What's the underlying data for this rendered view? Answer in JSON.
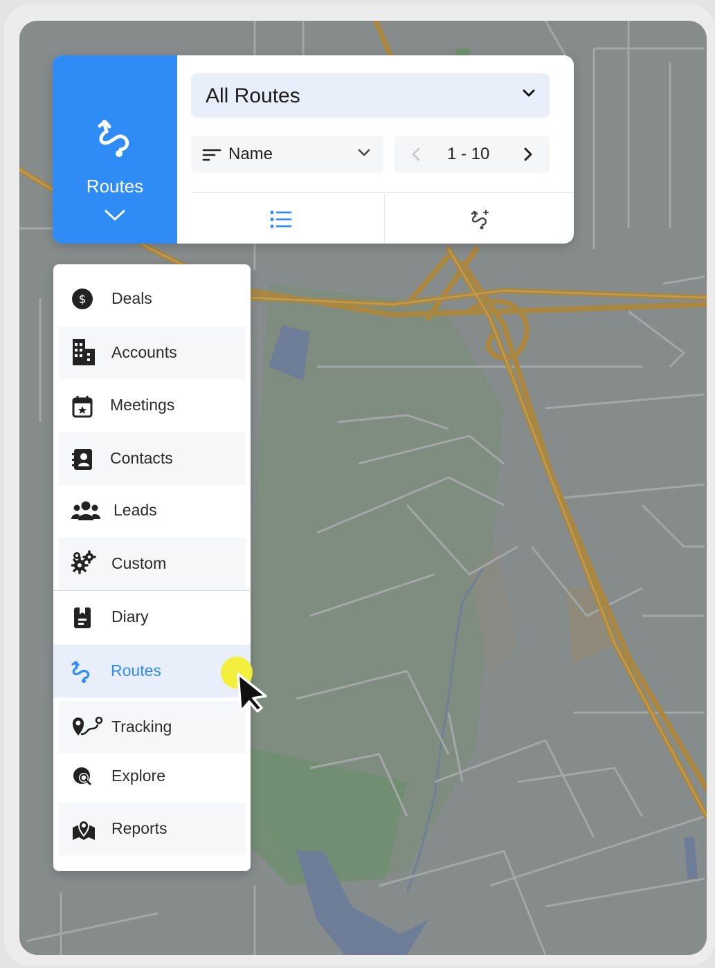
{
  "module_tile": {
    "label": "Routes",
    "icon": "route-icon"
  },
  "route_select": {
    "value": "All Routes"
  },
  "sort_select": {
    "value": "Name"
  },
  "pager": {
    "range": "1 - 10"
  },
  "tabs": [
    {
      "name": "list-view",
      "icon": "list-icon"
    },
    {
      "name": "add-route",
      "icon": "add-route-icon"
    }
  ],
  "menu": {
    "items": [
      {
        "label": "Deals",
        "icon": "dollar-icon"
      },
      {
        "label": "Accounts",
        "icon": "building-icon"
      },
      {
        "label": "Meetings",
        "icon": "calendar-icon"
      },
      {
        "label": "Contacts",
        "icon": "contact-book-icon"
      },
      {
        "label": "Leads",
        "icon": "users-icon"
      },
      {
        "label": "Custom",
        "icon": "gears-icon"
      },
      {
        "label": "Diary",
        "icon": "diary-icon"
      },
      {
        "label": "Routes",
        "icon": "route-icon",
        "active": true
      },
      {
        "label": "Tracking",
        "icon": "tracking-icon"
      },
      {
        "label": "Explore",
        "icon": "explore-icon"
      },
      {
        "label": "Reports",
        "icon": "reports-map-icon"
      }
    ]
  },
  "colors": {
    "accent": "#2f8cf7",
    "selected_bg": "#e8effb",
    "map_bg": "#868b8b",
    "highway": "#b08a3c",
    "cursor_highlight": "#f2ee33"
  }
}
